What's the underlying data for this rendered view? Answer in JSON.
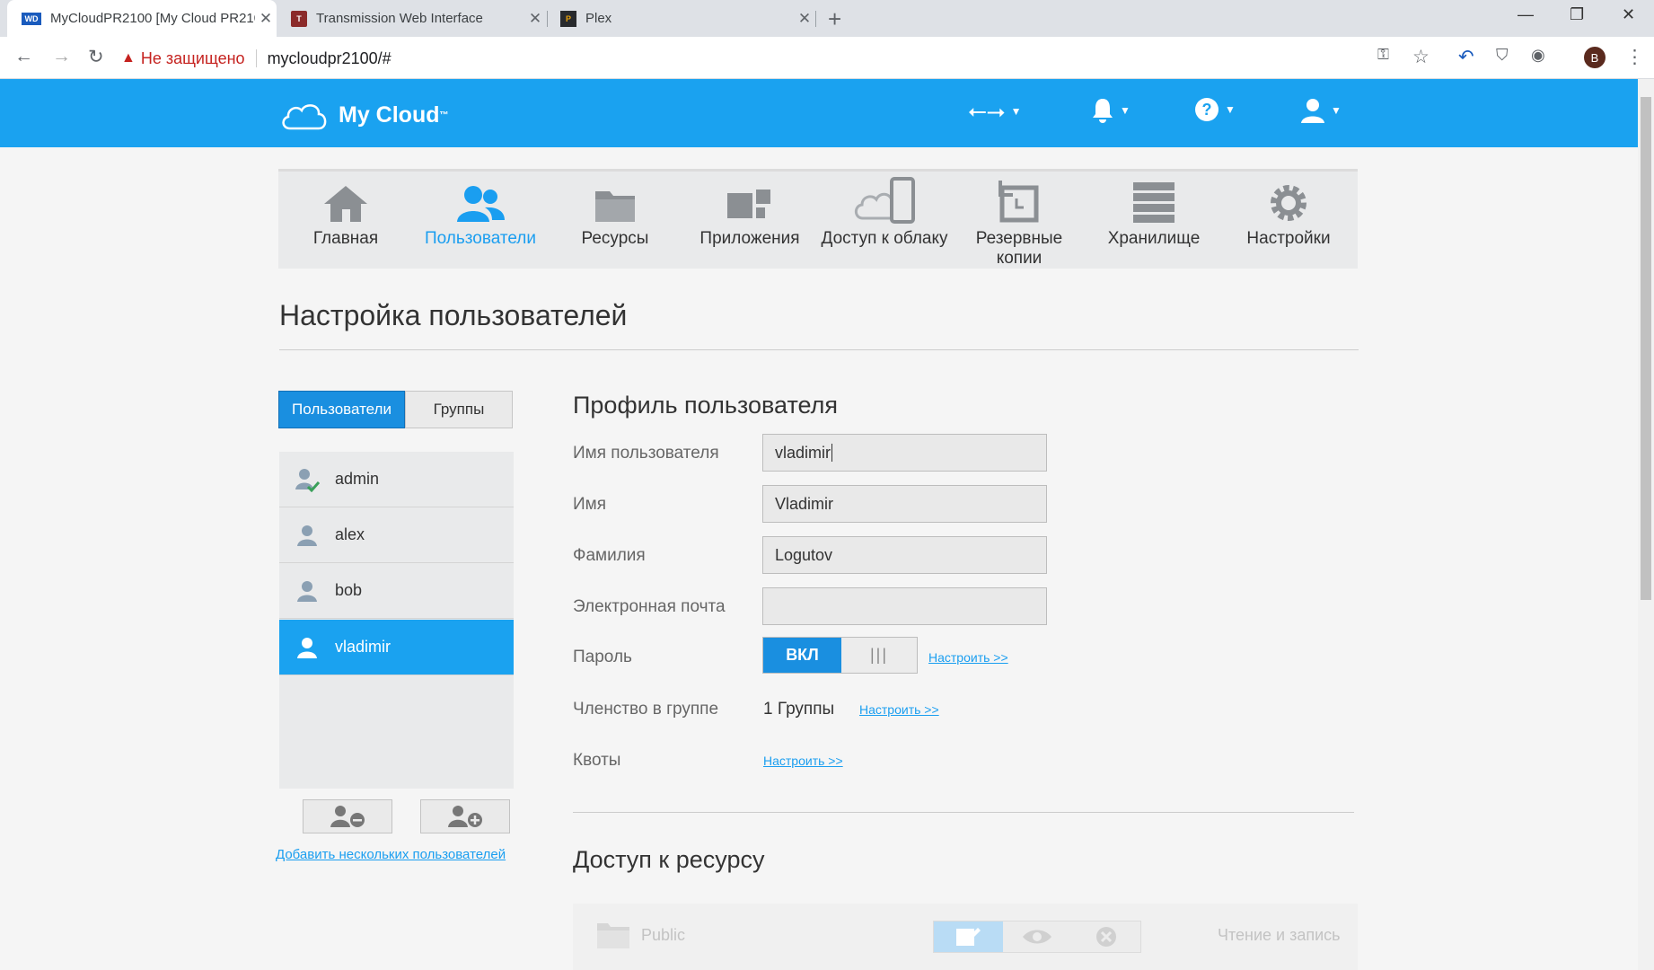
{
  "browser": {
    "tabs": [
      {
        "title": "MyCloudPR2100 [My Cloud PR2100]",
        "favicon": "WD"
      },
      {
        "title": "Transmission Web Interface",
        "favicon": "T"
      },
      {
        "title": "Plex",
        "favicon": "P"
      }
    ],
    "security_label": "Не защищено",
    "url": "mycloudpr2100/#",
    "profile_initial": "B"
  },
  "app": {
    "logo_text": "My Cloud",
    "logo_tm": "™",
    "nav": [
      {
        "label": "Главная",
        "icon": "home-icon"
      },
      {
        "label": "Пользователи",
        "icon": "users-icon"
      },
      {
        "label": "Ресурсы",
        "icon": "folder-icon"
      },
      {
        "label": "Приложения",
        "icon": "apps-icon"
      },
      {
        "label": "Доступ к облаку",
        "icon": "cloud-device-icon"
      },
      {
        "label": "Резервные копии",
        "icon": "backup-icon"
      },
      {
        "label": "Хранилище",
        "icon": "storage-icon"
      },
      {
        "label": "Настройки",
        "icon": "gear-icon"
      }
    ],
    "active_nav": "Пользователи",
    "accent_color": "#1aa2f0"
  },
  "page": {
    "title": "Настройка пользователей",
    "toggle": {
      "users": "Пользователи",
      "groups": "Группы"
    },
    "users": [
      "admin",
      "alex",
      "bob",
      "vladimir"
    ],
    "selected_user": "vladimir",
    "add_many_link": "Добавить нескольких пользователей"
  },
  "profile": {
    "title": "Профиль пользователя",
    "username_label": "Имя пользователя",
    "username": "vladimir",
    "first_name_label": "Имя",
    "first_name": "Vladimir",
    "last_name_label": "Фамилия",
    "last_name": "Logutov",
    "email_label": "Электронная почта",
    "email": "",
    "password_label": "Пароль",
    "password_on": "ВКЛ",
    "password_off": "|||",
    "configure": "Настроить >>",
    "group_label": "Членство в группе",
    "group_value": "1 Группы",
    "quota_label": "Квоты"
  },
  "access": {
    "title": "Доступ к ресурсу",
    "share_name": "Public",
    "permission": "Чтение и запись"
  }
}
